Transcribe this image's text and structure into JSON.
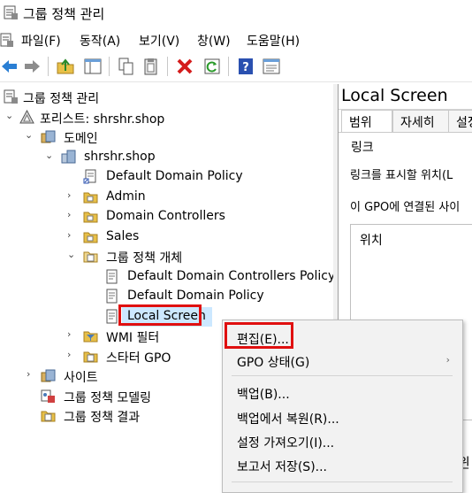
{
  "window": {
    "title": "그룹 정책 관리"
  },
  "menu": {
    "items": [
      {
        "label": "파일(F)"
      },
      {
        "label": "동작(A)"
      },
      {
        "label": "보기(V)"
      },
      {
        "label": "창(W)"
      },
      {
        "label": "도움말(H)"
      }
    ]
  },
  "toolbar": {
    "icons": [
      "back-icon",
      "forward-icon",
      "up-folder-icon",
      "show-tree-icon",
      "copy-icon",
      "paste-icon",
      "delete-icon",
      "refresh-icon",
      "help-icon",
      "properties-icon"
    ]
  },
  "tree": {
    "root": "그룹 정책 관리",
    "forest": "포리스트: shrshr.shop",
    "domains": "도메인",
    "domain": "shrshr.shop",
    "default_domain_policy": "Default Domain Policy",
    "admin": "Admin",
    "domain_controllers": "Domain Controllers",
    "sales": "Sales",
    "gpo_objects": "그룹 정책 개체",
    "ddcp": "Default Domain Controllers Policy",
    "ddp": "Default Domain Policy",
    "local_screen": "Local Screen",
    "wmi_filter": "WMI 필터",
    "starter_gpo": "스타터 GPO",
    "sites": "사이트",
    "modeling": "그룹 정책 모델링",
    "results": "그룹 정책 결과"
  },
  "right_pane": {
    "title": "Local Screen",
    "tabs": [
      "범위",
      "자세히",
      "설정"
    ],
    "links_label": "링크",
    "display_label": "링크를 표시할 위치(L",
    "connected_label": "이 GPO에 연결된 사이",
    "column_location": "위치",
    "bottom_glyph": "윈"
  },
  "context_menu": {
    "items": [
      {
        "label": "편집(E)..."
      },
      {
        "label": "GPO 상태(G)"
      },
      {
        "label": "백업(B)..."
      },
      {
        "label": "백업에서 복원(R)..."
      },
      {
        "label": "설정 가져오기(I)..."
      },
      {
        "label": "보고서 저장(S)..."
      }
    ]
  },
  "colors": {
    "highlight": "#e01010",
    "selection": "#cce8ff"
  }
}
